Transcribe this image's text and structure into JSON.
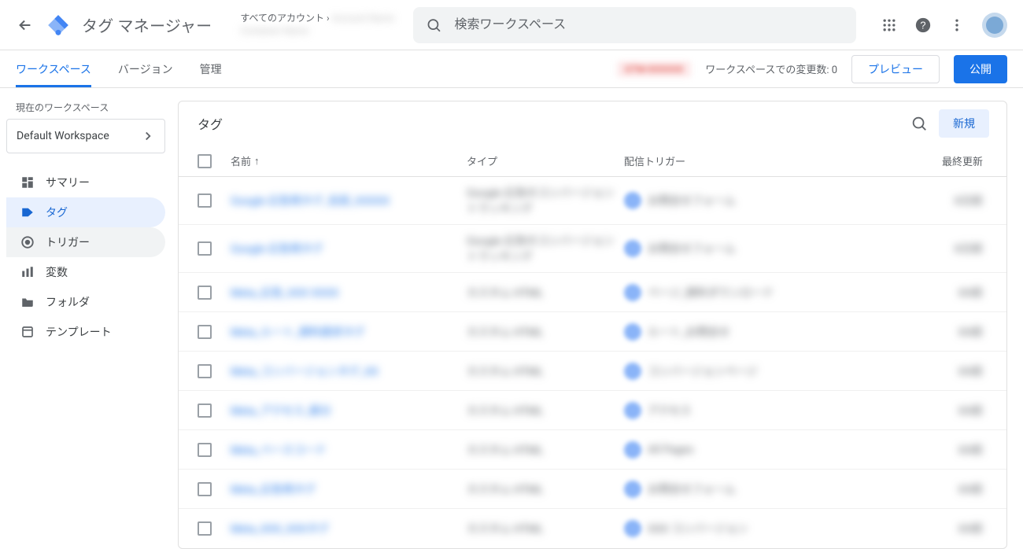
{
  "top": {
    "product": "タグ マネージャー",
    "breadcrumb_prefix": "すべてのアカウント ›",
    "breadcrumb_account_blurred": "Account Name",
    "breadcrumb_container_blurred": "Container Name",
    "search_placeholder": "検索ワークスペース"
  },
  "second": {
    "tabs": [
      "ワークスペース",
      "バージョン",
      "管理"
    ],
    "active_tab_index": 0,
    "badge_blurred": "GTM-XXXXXX",
    "changes_text": "ワークスペースでの変更数: 0",
    "preview_label": "プレビュー",
    "publish_label": "公開"
  },
  "sidebar": {
    "workspace_caption": "現在のワークスペース",
    "workspace_name": "Default Workspace",
    "items": [
      {
        "label": "サマリー"
      },
      {
        "label": "タグ"
      },
      {
        "label": "トリガー"
      },
      {
        "label": "変数"
      },
      {
        "label": "フォルダ"
      },
      {
        "label": "テンプレート"
      }
    ],
    "active_index": 1,
    "hover_index": 2
  },
  "card": {
    "title": "タグ",
    "new_label": "新規",
    "columns": {
      "name": "名前",
      "type": "タイプ",
      "trigger": "配信トリガー",
      "updated": "最終更新"
    },
    "rows": [
      {
        "name": "Google 広告用タグ_名前_XXXXX",
        "type": "Google 広告のコンバージョン トラッキング",
        "trigger": "お問合せフォーム",
        "date": "X日前"
      },
      {
        "name": "Google 広告用タグ",
        "type": "Google 広告のコンバージョン トラッキング",
        "trigger": "お問合せフォーム",
        "date": "X日前"
      },
      {
        "name": "Meta_広告_XXX XXXX",
        "type": "カスタム HTML",
        "trigger": "ページ_資料ダウンロード",
        "date": "XX前"
      },
      {
        "name": "Meta_ルート_資料請求タグ",
        "type": "カスタム HTML",
        "trigger": "ルート_お問合せ",
        "date": "XX前"
      },
      {
        "name": "Meta_コンバージョンタグ_XX",
        "type": "カスタム HTML",
        "trigger": "コンバージョンページ",
        "date": "XX前"
      },
      {
        "name": "Meta_アクセス_振分",
        "type": "カスタム HTML",
        "trigger": "アクセス",
        "date": "XX前"
      },
      {
        "name": "Meta_ベースコード",
        "type": "カスタム HTML",
        "trigger": "All Pages",
        "date": "XX前"
      },
      {
        "name": "Meta_広告用タグ",
        "type": "カスタム HTML",
        "trigger": "お問合せフォーム",
        "date": "XX前"
      },
      {
        "name": "Meta_XXX_XXXタグ",
        "type": "カスタム HTML",
        "trigger": "XXX コンバージョン",
        "date": "XX前"
      }
    ]
  }
}
